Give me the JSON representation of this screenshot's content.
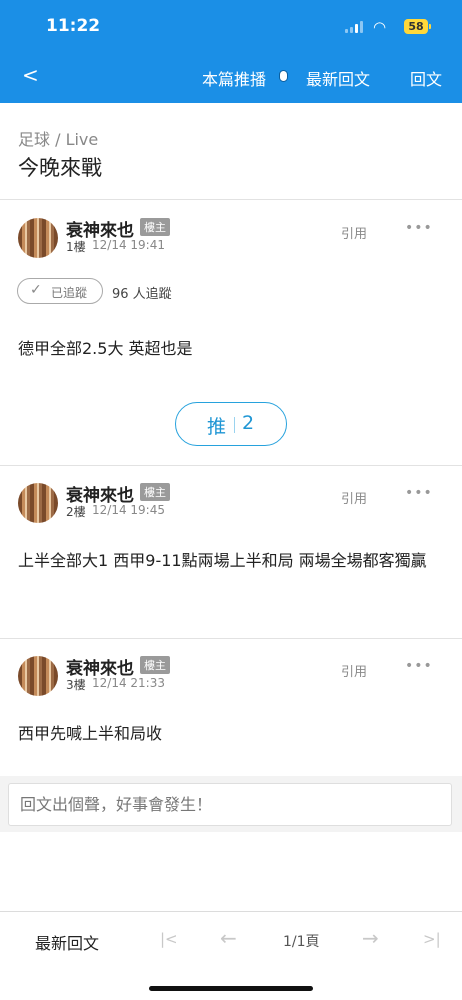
{
  "status_bar": {
    "time": "11:22",
    "battery": "58"
  },
  "nav": {
    "back_icon": "chevron-left-icon",
    "live": "本篇推播",
    "latest": "最新回文",
    "reply": "回文"
  },
  "thread": {
    "breadcrumb": "足球 / Live",
    "title": "今晚來戰"
  },
  "posts": [
    {
      "author": "衰神來也",
      "badge": "樓主",
      "floor": "1樓",
      "time": "12/14 19:41",
      "quote": "引用",
      "more": "•••",
      "body": "德甲全部2.5大 英超也是"
    },
    {
      "author": "衰神來也",
      "badge": "樓主",
      "floor": "2樓",
      "time": "12/14 19:45",
      "quote": "引用",
      "more": "•••",
      "body": "上半全部大1 西甲9-11點兩場上半和局 兩場全場都客獨贏"
    },
    {
      "author": "衰神來也",
      "badge": "樓主",
      "floor": "3樓",
      "time": "12/14 21:33",
      "quote": "引用",
      "more": "•••",
      "body": "西甲先喊上半和局收"
    }
  ],
  "follow": {
    "label": "已追蹤",
    "count": "96 人追蹤"
  },
  "push": {
    "label": "推",
    "count": "2"
  },
  "reply_input": {
    "placeholder": "回文出個聲，好事會發生！"
  },
  "bottom": {
    "latest": "最新回文",
    "first": "|<",
    "prev": "←",
    "page": "1/1頁",
    "next": "→",
    "last": ">|"
  },
  "colors": {
    "brand": "#1b8fe6",
    "accent": "#27a2dd"
  }
}
